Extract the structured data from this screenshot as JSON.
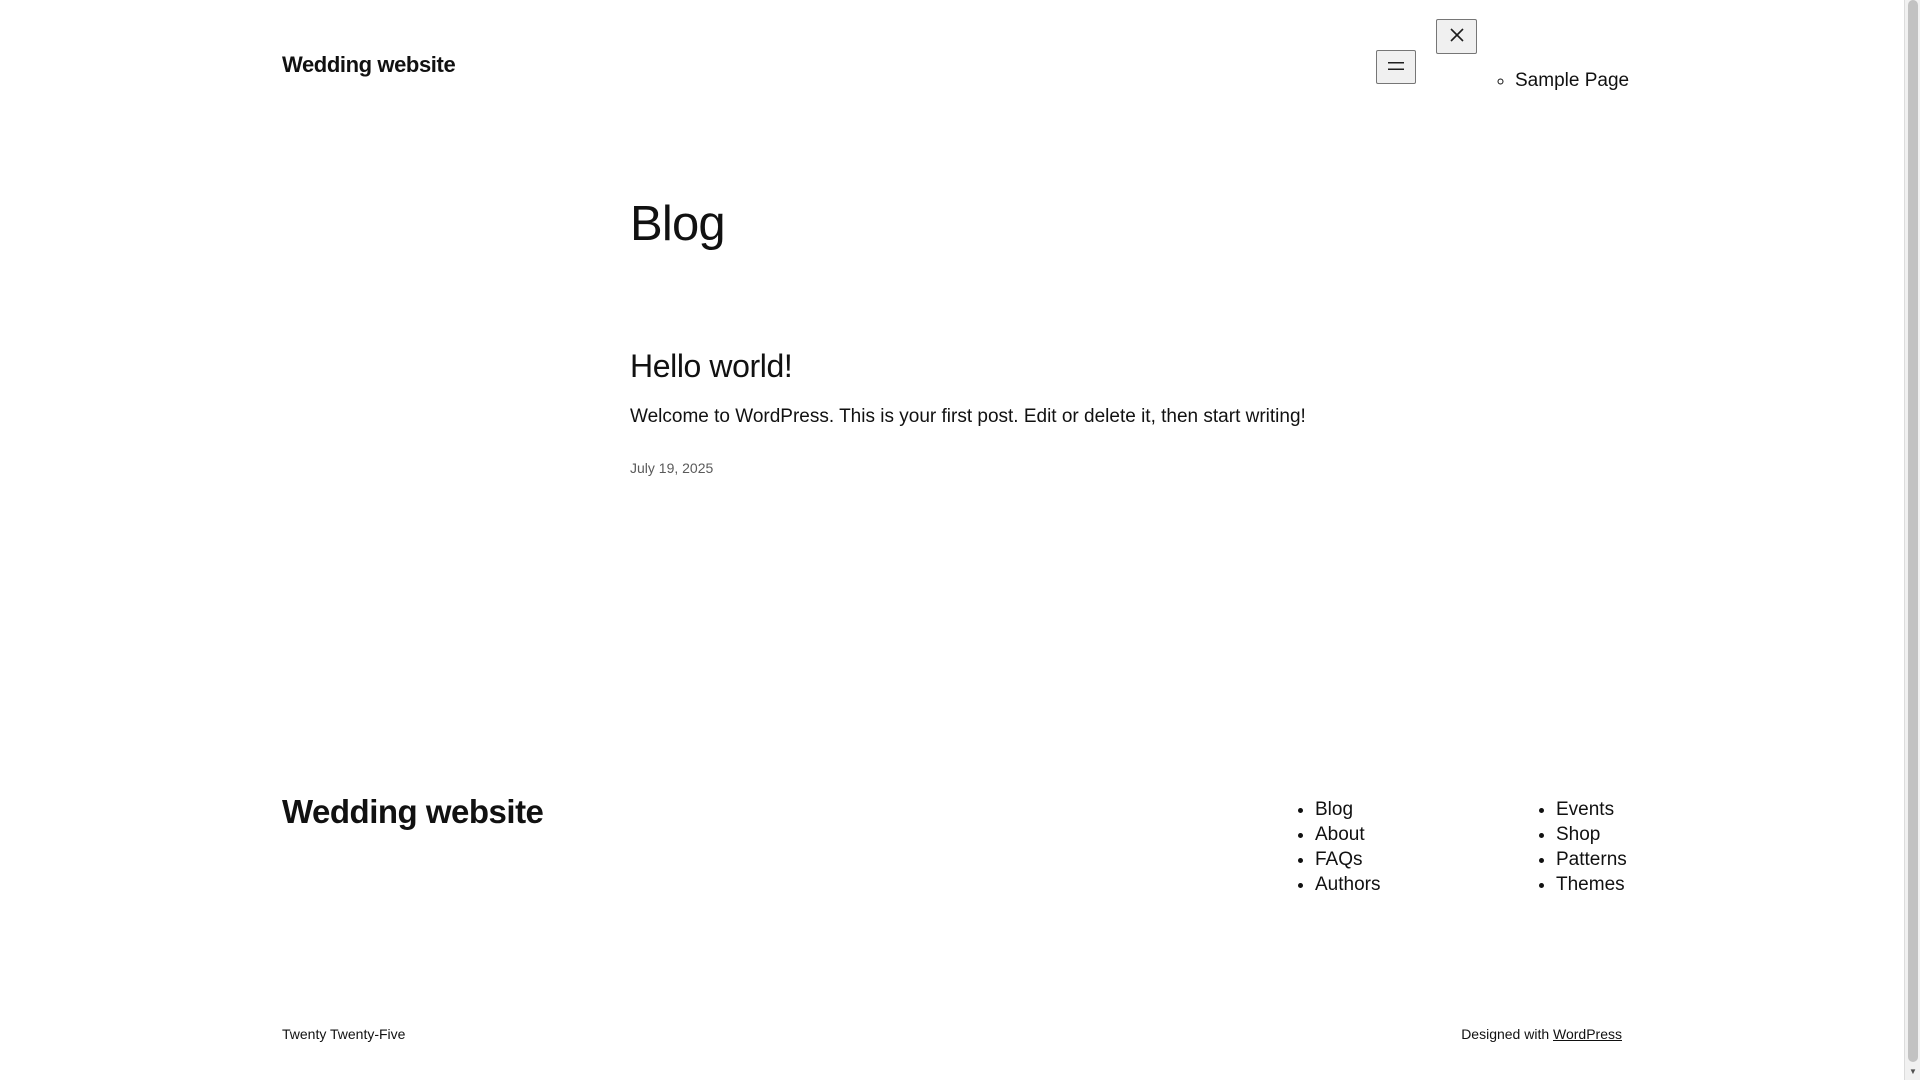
{
  "header": {
    "site_title": "Wedding website",
    "menu_open_icon": "hamburger-menu-icon",
    "menu_close_icon": "close-icon",
    "nav_items": [
      {
        "label": "Sample Page"
      }
    ]
  },
  "main": {
    "page_heading": "Blog",
    "posts": [
      {
        "title": "Hello world!",
        "excerpt": "Welcome to WordPress. This is your first post. Edit or delete it, then start writing!",
        "date": "July 19, 2025"
      }
    ]
  },
  "footer": {
    "site_title": "Wedding website",
    "nav_col1": [
      "Blog",
      "About",
      "FAQs",
      "Authors"
    ],
    "nav_col2": [
      "Events",
      "Shop",
      "Patterns",
      "Themes"
    ],
    "theme_credit": "Twenty Twenty-Five",
    "designed_with_prefix": "Designed with ",
    "designed_with_link": "WordPress"
  },
  "colors": {
    "text": "#111111",
    "background": "#ffffff",
    "muted": "#5a5a5a"
  }
}
